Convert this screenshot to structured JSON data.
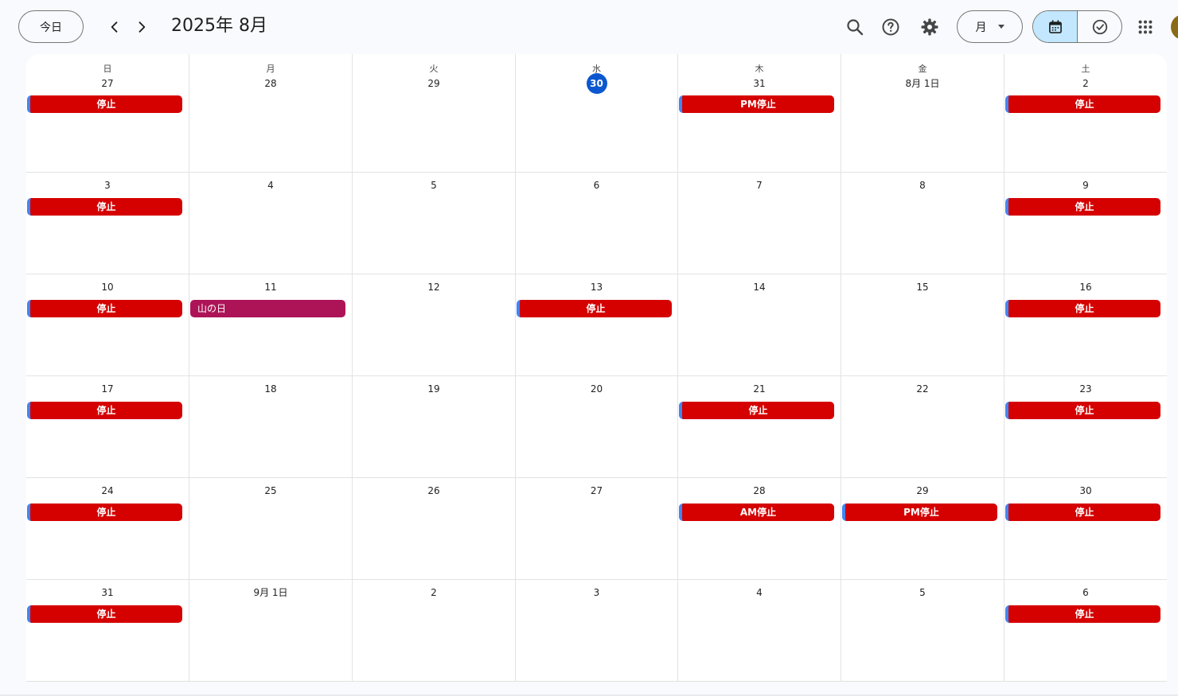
{
  "header": {
    "today_label": "今日",
    "title": "2025年 8月",
    "view_label": "月"
  },
  "colors": {
    "event_red": "#d50000",
    "event_holiday": "#ad1457",
    "event_stripe": "#4285f4",
    "today_blue": "#0b57d0",
    "segment_active": "#c2e7ff"
  },
  "icons": {
    "prev": "chevron-left-icon",
    "next": "chevron-right-icon",
    "search": "search-icon",
    "help": "help-icon",
    "settings": "gear-icon",
    "calendar_view": "calendar-icon",
    "tasks_view": "check-circle-icon",
    "apps": "apps-grid-icon"
  },
  "calendar": {
    "weekdays": [
      "日",
      "月",
      "火",
      "水",
      "木",
      "金",
      "土"
    ],
    "weeks": [
      [
        {
          "day": "27",
          "events": [
            {
              "title": "停止",
              "color": "#d50000",
              "stripe": true
            }
          ]
        },
        {
          "day": "28",
          "events": []
        },
        {
          "day": "29",
          "events": []
        },
        {
          "day": "30",
          "today": true,
          "events": []
        },
        {
          "day": "31",
          "events": [
            {
              "title": "PM停止",
              "color": "#d50000",
              "stripe": true
            }
          ]
        },
        {
          "day": "8月 1日",
          "events": []
        },
        {
          "day": "2",
          "events": [
            {
              "title": "停止",
              "color": "#d50000",
              "stripe": true
            }
          ]
        }
      ],
      [
        {
          "day": "3",
          "events": [
            {
              "title": "停止",
              "color": "#d50000",
              "stripe": true
            }
          ]
        },
        {
          "day": "4",
          "events": []
        },
        {
          "day": "5",
          "events": []
        },
        {
          "day": "6",
          "events": []
        },
        {
          "day": "7",
          "events": []
        },
        {
          "day": "8",
          "events": []
        },
        {
          "day": "9",
          "events": [
            {
              "title": "停止",
              "color": "#d50000",
              "stripe": true
            }
          ]
        }
      ],
      [
        {
          "day": "10",
          "events": [
            {
              "title": "停止",
              "color": "#d50000",
              "stripe": true
            }
          ]
        },
        {
          "day": "11",
          "events": [
            {
              "title": "山の日",
              "color": "#ad1457",
              "stripe": false
            }
          ]
        },
        {
          "day": "12",
          "events": []
        },
        {
          "day": "13",
          "events": [
            {
              "title": "停止",
              "color": "#d50000",
              "stripe": true
            }
          ]
        },
        {
          "day": "14",
          "events": []
        },
        {
          "day": "15",
          "events": []
        },
        {
          "day": "16",
          "events": [
            {
              "title": "停止",
              "color": "#d50000",
              "stripe": true
            }
          ]
        }
      ],
      [
        {
          "day": "17",
          "events": [
            {
              "title": "停止",
              "color": "#d50000",
              "stripe": true
            }
          ]
        },
        {
          "day": "18",
          "events": []
        },
        {
          "day": "19",
          "events": []
        },
        {
          "day": "20",
          "events": []
        },
        {
          "day": "21",
          "events": [
            {
              "title": "停止",
              "color": "#d50000",
              "stripe": true
            }
          ]
        },
        {
          "day": "22",
          "events": []
        },
        {
          "day": "23",
          "events": [
            {
              "title": "停止",
              "color": "#d50000",
              "stripe": true
            }
          ]
        }
      ],
      [
        {
          "day": "24",
          "events": [
            {
              "title": "停止",
              "color": "#d50000",
              "stripe": true
            }
          ]
        },
        {
          "day": "25",
          "events": []
        },
        {
          "day": "26",
          "events": []
        },
        {
          "day": "27",
          "events": []
        },
        {
          "day": "28",
          "events": [
            {
              "title": "AM停止",
              "color": "#d50000",
              "stripe": true
            }
          ]
        },
        {
          "day": "29",
          "events": [
            {
              "title": "PM停止",
              "color": "#d50000",
              "stripe": true
            }
          ]
        },
        {
          "day": "30",
          "events": [
            {
              "title": "停止",
              "color": "#d50000",
              "stripe": true
            }
          ]
        }
      ],
      [
        {
          "day": "31",
          "events": [
            {
              "title": "停止",
              "color": "#d50000",
              "stripe": true
            }
          ]
        },
        {
          "day": "9月 1日",
          "events": []
        },
        {
          "day": "2",
          "events": []
        },
        {
          "day": "3",
          "events": []
        },
        {
          "day": "4",
          "events": []
        },
        {
          "day": "5",
          "events": []
        },
        {
          "day": "6",
          "events": [
            {
              "title": "停止",
              "color": "#d50000",
              "stripe": true
            }
          ]
        }
      ]
    ]
  }
}
